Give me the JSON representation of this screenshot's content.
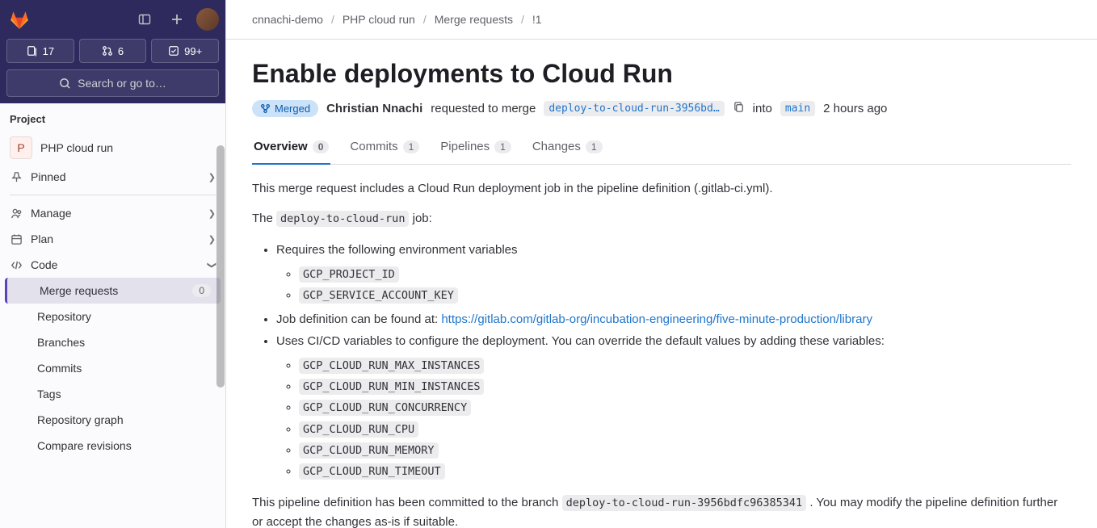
{
  "header": {
    "counters": {
      "issues": "17",
      "mrs": "6",
      "todos": "99+"
    },
    "search_label": "Search or go to…"
  },
  "sidebar": {
    "section": "Project",
    "project": {
      "initial": "P",
      "name": "PHP cloud run"
    },
    "items": {
      "pinned": "Pinned",
      "manage": "Manage",
      "plan": "Plan",
      "code": "Code",
      "merge_requests": "Merge requests",
      "mr_count": "0",
      "repository": "Repository",
      "branches": "Branches",
      "commits": "Commits",
      "tags": "Tags",
      "repo_graph": "Repository graph",
      "compare": "Compare revisions"
    }
  },
  "breadcrumbs": {
    "group": "cnnachi-demo",
    "project": "PHP cloud run",
    "section": "Merge requests",
    "id": "!1"
  },
  "mr": {
    "title": "Enable deployments to Cloud Run",
    "status": "Merged",
    "author": "Christian Nnachi",
    "action": "requested to merge",
    "source_branch": "deploy-to-cloud-run-3956bd…",
    "into": "into",
    "target_branch": "main",
    "time": "2 hours ago"
  },
  "tabs": {
    "overview": {
      "label": "Overview",
      "count": "0"
    },
    "commits": {
      "label": "Commits",
      "count": "1"
    },
    "pipelines": {
      "label": "Pipelines",
      "count": "1"
    },
    "changes": {
      "label": "Changes",
      "count": "1"
    }
  },
  "desc": {
    "intro": "This merge request includes a Cloud Run deployment job in the pipeline definition (.gitlab-ci.yml).",
    "the": "The ",
    "job_code": "deploy-to-cloud-run",
    "job_suffix": " job:",
    "req_env": "Requires the following environment variables",
    "env1": "GCP_PROJECT_ID",
    "env2": "GCP_SERVICE_ACCOUNT_KEY",
    "job_def_prefix": "Job definition can be found at: ",
    "job_def_link": "https://gitlab.com/gitlab-org/incubation-engineering/five-minute-production/library",
    "cicd_vars": "Uses CI/CD variables to configure the deployment. You can override the default values by adding these variables:",
    "v1": "GCP_CLOUD_RUN_MAX_INSTANCES",
    "v2": "GCP_CLOUD_RUN_MIN_INSTANCES",
    "v3": "GCP_CLOUD_RUN_CONCURRENCY",
    "v4": "GCP_CLOUD_RUN_CPU",
    "v5": "GCP_CLOUD_RUN_MEMORY",
    "v6": "GCP_CLOUD_RUN_TIMEOUT",
    "outro_pre": "This pipeline definition has been committed to the branch ",
    "outro_branch": "deploy-to-cloud-run-3956bdfc96385341",
    "outro_post": " . You may modify the pipeline definition further or accept the changes as-is if suitable."
  }
}
